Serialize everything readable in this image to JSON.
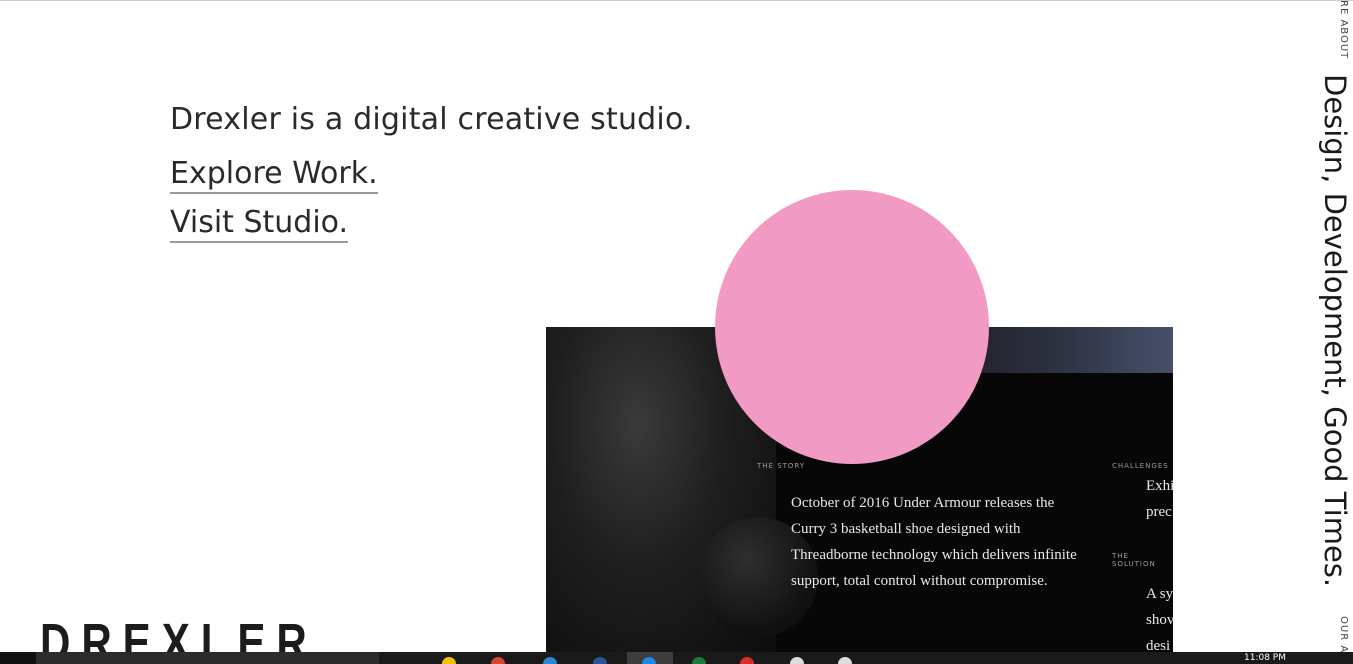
{
  "hero": {
    "intro": "Drexler is a digital creative studio.",
    "explore_link": "Explore Work.",
    "studio_link": "Visit Studio."
  },
  "brand": {
    "wordmark": "DREXLER"
  },
  "side": {
    "tagline": "Design, Development, Good Times.",
    "top_label": "RE ABOUT",
    "bottom_label": "OUR A"
  },
  "showcase": {
    "story_label": "THE STORY",
    "challenges_label": "CHALLENGES",
    "solution_label": "THE SOLUTION",
    "story_text": "October of 2016 Under Armour releases the Curry 3 basketball shoe designed with Threadborne technology which delivers infinite support, total control without compromise.",
    "challenges_clip": "Exhi\nprec",
    "solution_clip": "A sy\nshov\ndesi"
  },
  "accent": {
    "pink": "#f09ac4"
  },
  "taskbar": {
    "clock": "11:08 PM",
    "icons": [
      {
        "name": "file-explorer-icon",
        "color": "#f2c200"
      },
      {
        "name": "office-icon",
        "color": "#d9442f"
      },
      {
        "name": "edge-icon",
        "color": "#2b88d8"
      },
      {
        "name": "word-icon",
        "color": "#2b5797"
      },
      {
        "name": "browser-icon",
        "color": "#1e88e5"
      },
      {
        "name": "excel-icon",
        "color": "#1f7a3f"
      },
      {
        "name": "chrome-icon",
        "color": "#d93025"
      },
      {
        "name": "app-icon",
        "color": "#dddddd"
      },
      {
        "name": "clapper-icon",
        "color": "#dddddd"
      }
    ]
  }
}
